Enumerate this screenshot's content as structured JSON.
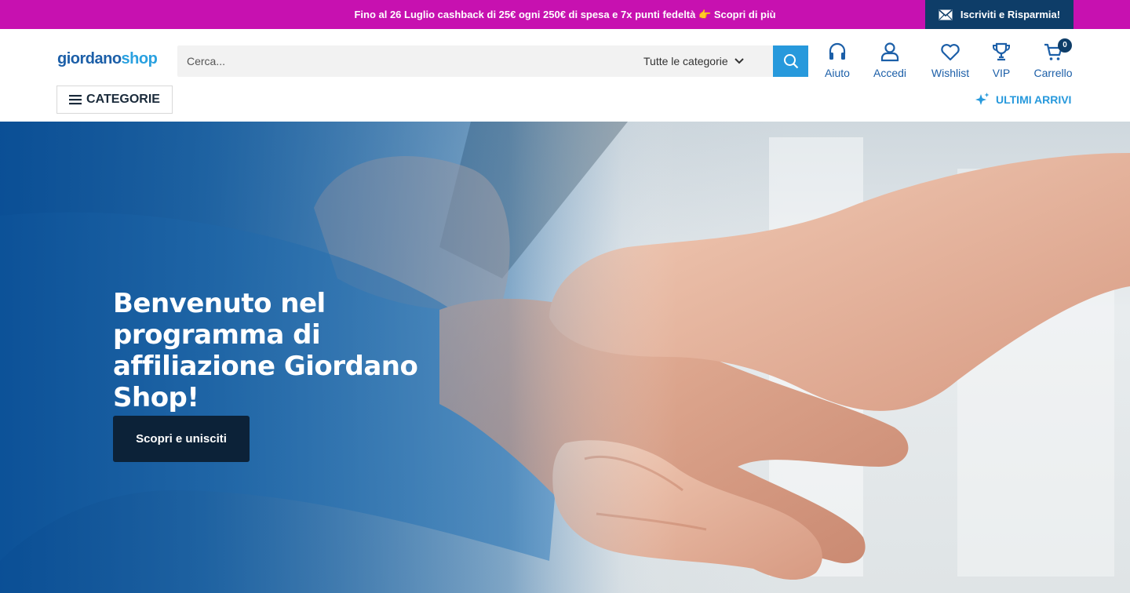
{
  "promo": {
    "text": "Fino al 26 Luglio cashback di 25€ ogni 250€ di spesa e 7x punti fedeltà",
    "emoji": "👉",
    "cta": "Scopri di più",
    "background": "#c711b0"
  },
  "subscribe": {
    "icon": "mail-icon",
    "label": "Iscriviti e Risparmia!",
    "background": "#0e3d68"
  },
  "header": {
    "logo": {
      "part1": "giordano",
      "part2": "shop"
    },
    "search": {
      "placeholder": "Cerca...",
      "value": "",
      "category_label": "Tutte le categorie",
      "button_icon": "search-icon",
      "button_color": "#2799dc"
    },
    "nav": [
      {
        "label": "Aiuto",
        "icon": "headphones-icon"
      },
      {
        "label": "Accedi",
        "icon": "user-icon"
      },
      {
        "label": "Wishlist",
        "icon": "heart-icon"
      },
      {
        "label": "VIP",
        "icon": "trophy-icon"
      },
      {
        "label": "Carrello",
        "icon": "cart-icon",
        "badge": "0"
      }
    ],
    "categories_label": "CATEGORIE",
    "new_arrivals_label": "ULTIMI ARRIVI",
    "accent": "#1c5fa8"
  },
  "hero": {
    "title": "Benvenuto nel programma di affiliazione Giordano Shop!",
    "cta": "Scopri e unisciti",
    "cta_background": "#0c2238"
  }
}
